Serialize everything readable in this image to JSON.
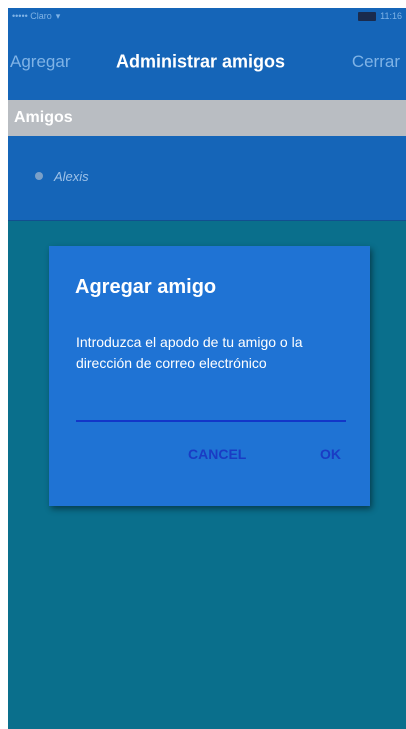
{
  "status_bar": {
    "carrier": "••••• Claro",
    "time": "11:16"
  },
  "nav": {
    "left_label": "Agregar",
    "title": "Administrar amigos",
    "right_label": "Cerrar"
  },
  "section": {
    "header": "Amigos"
  },
  "friends": [
    {
      "name": "Alexis"
    }
  ],
  "dialog": {
    "title": "Agregar amigo",
    "message": "Introduzca el apodo de tu amigo o la dirección de correo electrónico",
    "input_value": "",
    "input_placeholder": "",
    "cancel_label": "CANCEL",
    "ok_label": "OK"
  },
  "colors": {
    "background": "#0a6f8c",
    "nav": "#1565b8",
    "dialog": "#1f73d4",
    "accent": "#1a3cc4"
  }
}
